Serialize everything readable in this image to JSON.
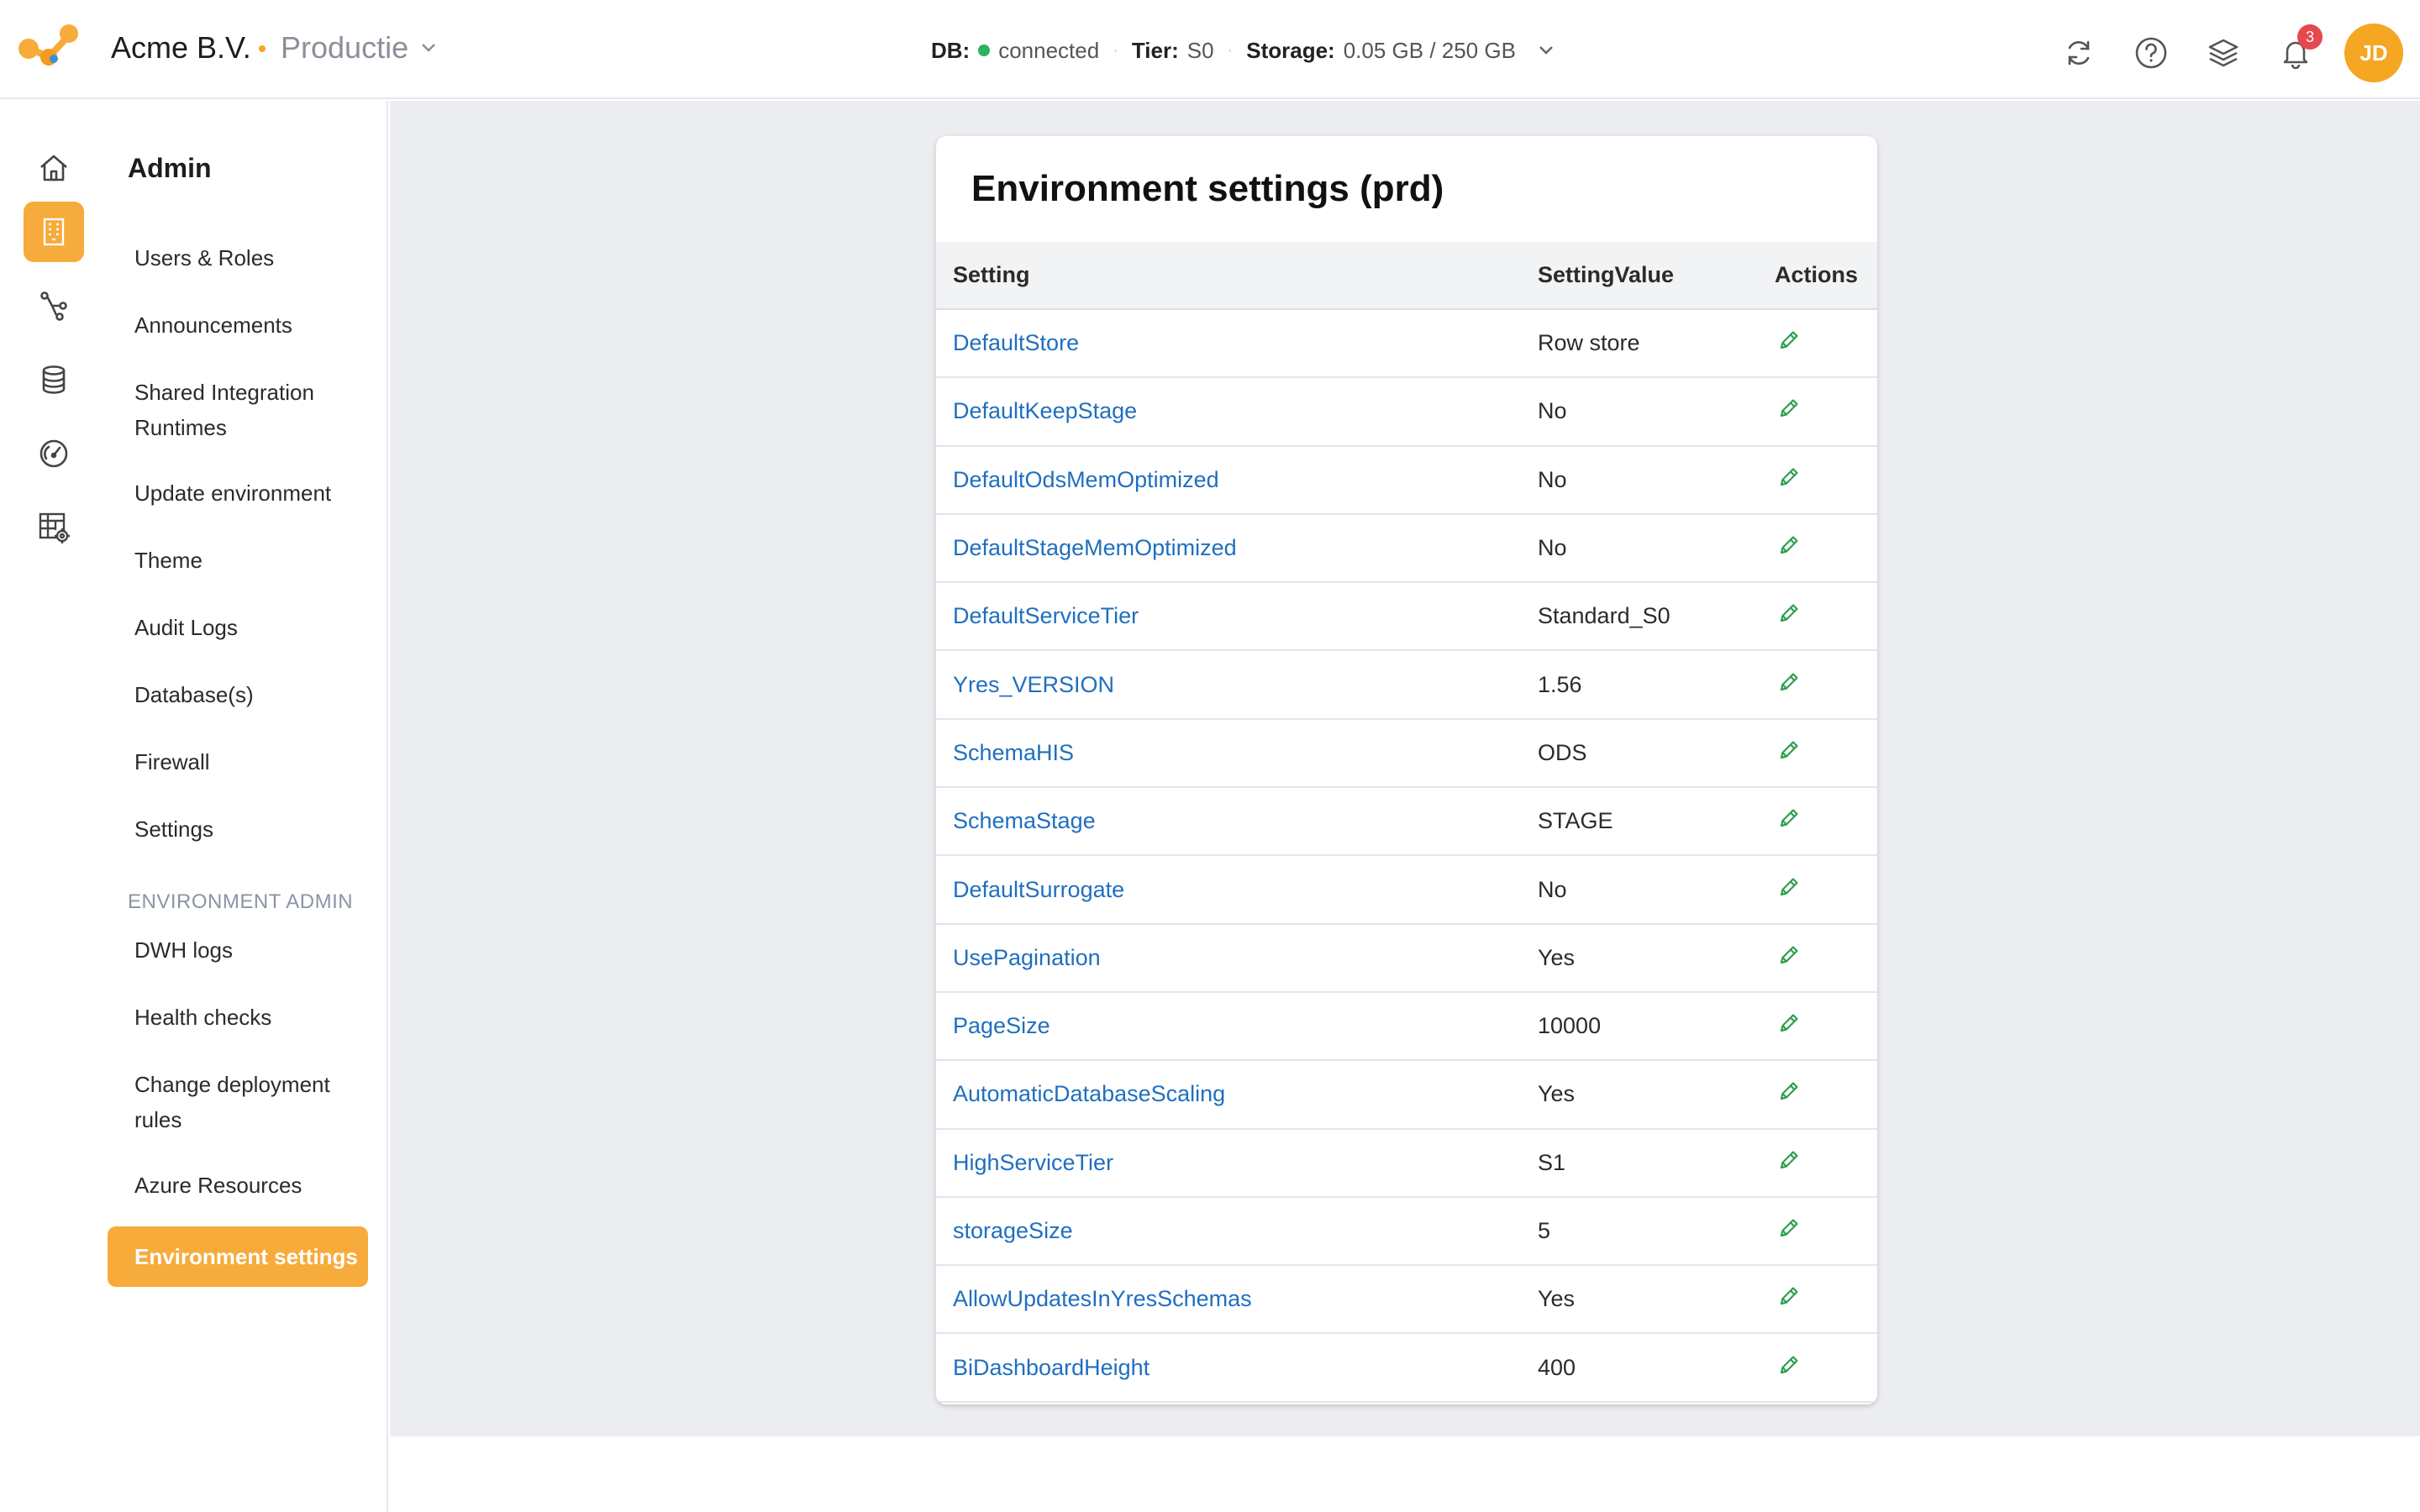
{
  "header": {
    "company": "Acme B.V.",
    "environment": "Productie",
    "status": {
      "db_label": "DB:",
      "db_value": "connected",
      "tier_label": "Tier:",
      "tier_value": "S0",
      "storage_label": "Storage:",
      "storage_value": "0.05 GB / 250 GB"
    },
    "notifications_count": "3",
    "avatar_initials": "JD"
  },
  "rail": {
    "icons": [
      "home-icon",
      "building-icon",
      "pipeline-icon",
      "database-icon",
      "gauge-icon",
      "table-settings-icon"
    ],
    "active_index": 1
  },
  "sidebar": {
    "title": "Admin",
    "items": [
      "Users & Roles",
      "Announcements",
      "Shared Integration Runtimes",
      "Update environment",
      "Theme",
      "Audit Logs",
      "Database(s)",
      "Firewall",
      "Settings"
    ],
    "group_label": "ENVIRONMENT ADMIN",
    "group_items": [
      "DWH logs",
      "Health checks",
      "Change deployment rules",
      "Azure Resources",
      "Environment settings"
    ],
    "active_item": "Environment settings"
  },
  "main": {
    "title": "Environment settings (prd)",
    "columns": [
      "Setting",
      "SettingValue",
      "Actions"
    ],
    "rows": [
      {
        "setting": "DefaultStore",
        "value": "Row store"
      },
      {
        "setting": "DefaultKeepStage",
        "value": "No"
      },
      {
        "setting": "DefaultOdsMemOptimized",
        "value": "No"
      },
      {
        "setting": "DefaultStageMemOptimized",
        "value": "No"
      },
      {
        "setting": "DefaultServiceTier",
        "value": "Standard_S0"
      },
      {
        "setting": "Yres_VERSION",
        "value": "1.56"
      },
      {
        "setting": "SchemaHIS",
        "value": "ODS"
      },
      {
        "setting": "SchemaStage",
        "value": "STAGE"
      },
      {
        "setting": "DefaultSurrogate",
        "value": "No"
      },
      {
        "setting": "UsePagination",
        "value": "Yes"
      },
      {
        "setting": "PageSize",
        "value": "10000"
      },
      {
        "setting": "AutomaticDatabaseScaling",
        "value": "Yes"
      },
      {
        "setting": "HighServiceTier",
        "value": "S1"
      },
      {
        "setting": "storageSize",
        "value": "5"
      },
      {
        "setting": "AllowUpdatesInYresSchemas",
        "value": "Yes"
      },
      {
        "setting": "BiDashboardHeight",
        "value": "400"
      }
    ]
  },
  "colors": {
    "accent": "#f7ab3b",
    "link": "#1f6fbf",
    "edit_icon": "#2e9e4f",
    "status_ok": "#2db35d",
    "badge": "#e5484d"
  }
}
